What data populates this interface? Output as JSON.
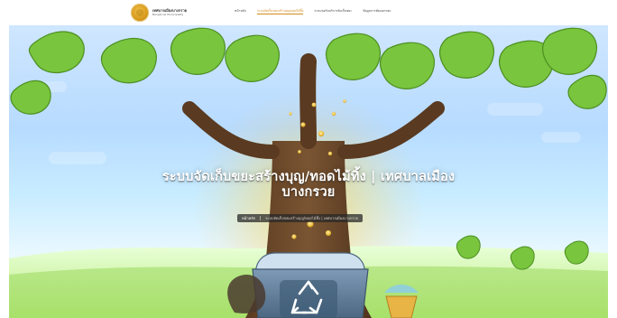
{
  "brand": {
    "logo": "municipality-seal",
    "title": "เทศบาลเมืองบางกรวย",
    "subtitle": "Bangkruai Municipality"
  },
  "nav": {
    "items": [
      {
        "label": "หน้าหลัก",
        "active": false
      },
      {
        "label": "ระบบจัดเก็บขยะสร้างบุญ/ทอดไม้ทิ้ง",
        "active": true
      },
      {
        "label": "ระบบขอรับบริการจัดเก็บขยะ",
        "active": false
      },
      {
        "label": "ข้อมูลการคัดแยกขยะ",
        "active": false
      }
    ]
  },
  "hero": {
    "title_line1": "ระบบจัดเก็บขยะสร้างบุญ/ทอดไม้ทิ้ง | เทศบาลเมือง",
    "title_line2": "บางกรวย",
    "breadcrumb": {
      "home": "หน้าหลัก",
      "current": "ระบบจัดเก็บขยะสร้างบุญ/ทอดไม้ทิ้ง | เทศบาลเมืองบางกรวย"
    }
  },
  "colors": {
    "accent": "#d48a1a",
    "leaf": "#79c53d",
    "trunk": "#6b4a2b",
    "bin": "#5a7c9a"
  },
  "icons": {
    "recycle": "recycle-icon"
  }
}
